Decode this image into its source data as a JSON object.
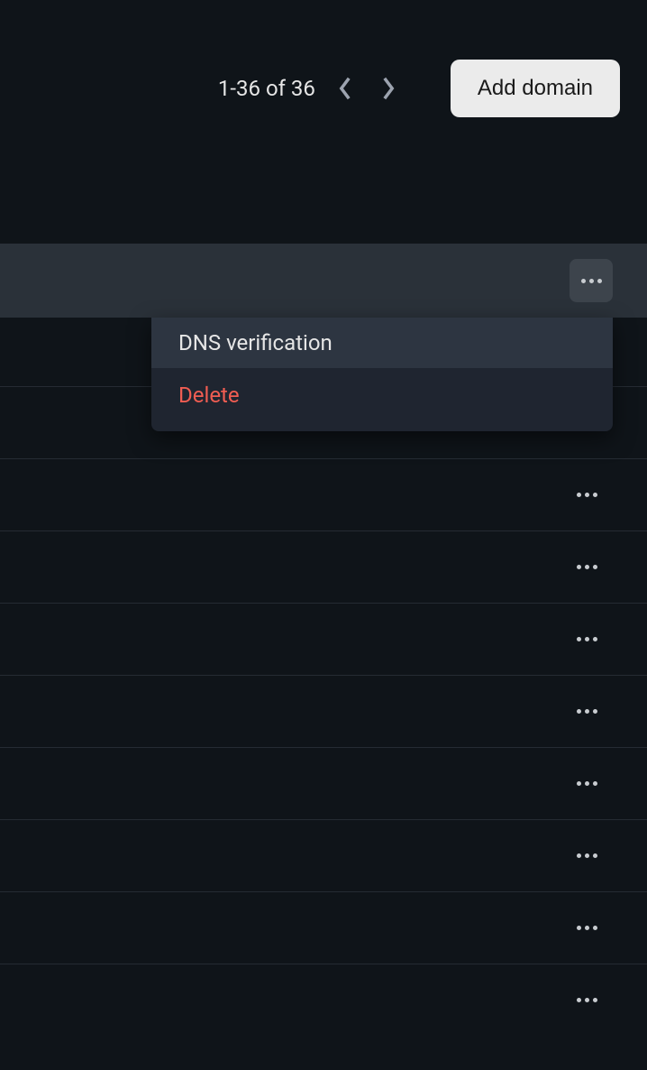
{
  "header": {
    "pagination_text": "1-36 of 36",
    "add_button_label": "Add domain"
  },
  "dropdown": {
    "dns_label": "DNS verification",
    "delete_label": "Delete"
  }
}
